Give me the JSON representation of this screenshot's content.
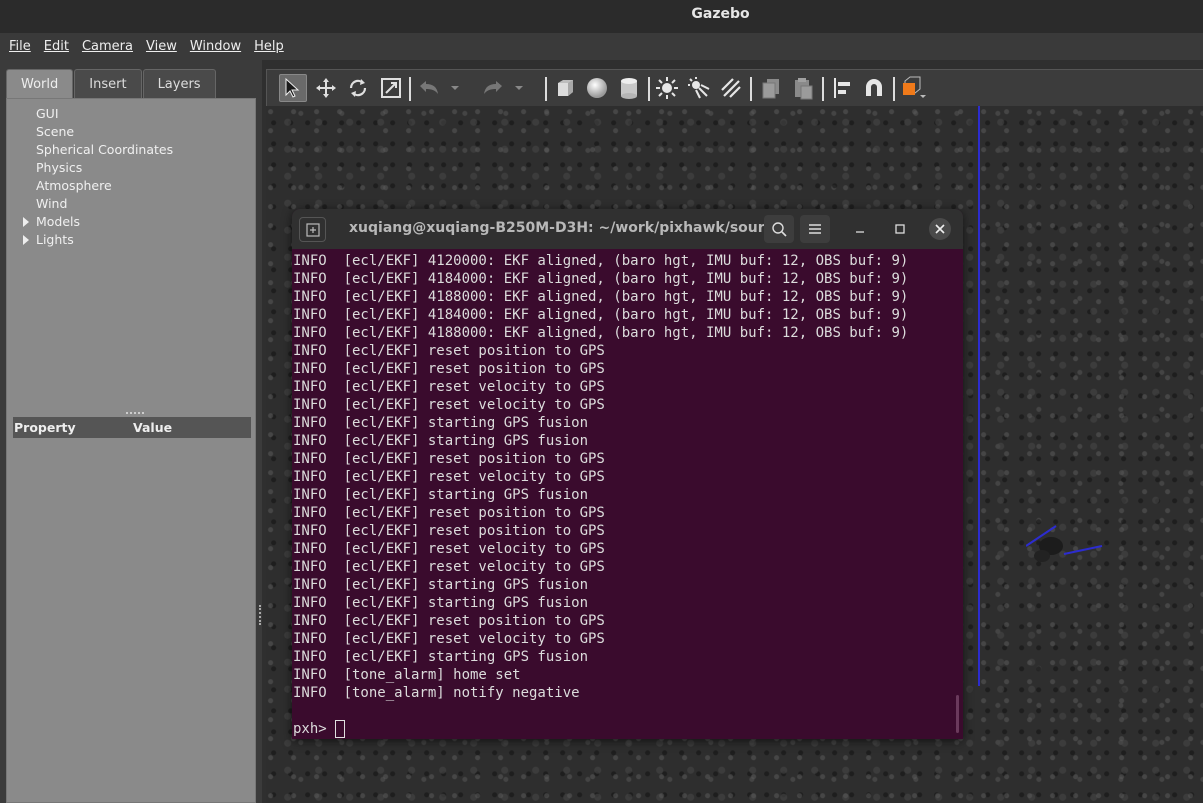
{
  "window": {
    "title": "Gazebo"
  },
  "menu": [
    {
      "label": "File"
    },
    {
      "label": "Edit"
    },
    {
      "label": "Camera"
    },
    {
      "label": "View"
    },
    {
      "label": "Window"
    },
    {
      "label": "Help"
    }
  ],
  "left_panel": {
    "tabs": [
      {
        "label": "World",
        "active": true
      },
      {
        "label": "Insert"
      },
      {
        "label": "Layers"
      }
    ],
    "tree": [
      {
        "label": "GUI",
        "expandable": false
      },
      {
        "label": "Scene",
        "expandable": false
      },
      {
        "label": "Spherical Coordinates",
        "expandable": false
      },
      {
        "label": "Physics",
        "expandable": false
      },
      {
        "label": "Atmosphere",
        "expandable": false
      },
      {
        "label": "Wind",
        "expandable": false
      },
      {
        "label": "Models",
        "expandable": true
      },
      {
        "label": "Lights",
        "expandable": true
      }
    ],
    "property_header": {
      "property": "Property",
      "value": "Value"
    }
  },
  "toolbar": {
    "tools": [
      {
        "icon": "select-arrow-icon",
        "active": true
      },
      {
        "icon": "translate-icon"
      },
      {
        "icon": "rotate-icon"
      },
      {
        "icon": "scale-icon"
      },
      {
        "icon": "undo-icon"
      },
      {
        "icon": "redo-icon"
      },
      {
        "icon": "box-shape-icon"
      },
      {
        "icon": "sphere-shape-icon"
      },
      {
        "icon": "cylinder-shape-icon"
      },
      {
        "icon": "point-light-icon"
      },
      {
        "icon": "spot-light-icon"
      },
      {
        "icon": "directional-light-icon"
      },
      {
        "icon": "copy-icon"
      },
      {
        "icon": "paste-icon"
      },
      {
        "icon": "align-icon"
      },
      {
        "icon": "snap-magnet-icon"
      },
      {
        "icon": "view-angle-icon"
      }
    ],
    "accent_color": "#f07a1a"
  },
  "terminal": {
    "title": "xuqiang@xuqiang-B250M-D3H: ~/work/pixhawk/sourc...",
    "background": "#3a0b2d",
    "lines": [
      "INFO  [ecl/EKF] 4120000: EKF aligned, (baro hgt, IMU buf: 12, OBS buf: 9)",
      "INFO  [ecl/EKF] 4184000: EKF aligned, (baro hgt, IMU buf: 12, OBS buf: 9)",
      "INFO  [ecl/EKF] 4188000: EKF aligned, (baro hgt, IMU buf: 12, OBS buf: 9)",
      "INFO  [ecl/EKF] 4184000: EKF aligned, (baro hgt, IMU buf: 12, OBS buf: 9)",
      "INFO  [ecl/EKF] 4188000: EKF aligned, (baro hgt, IMU buf: 12, OBS buf: 9)",
      "INFO  [ecl/EKF] reset position to GPS",
      "INFO  [ecl/EKF] reset position to GPS",
      "INFO  [ecl/EKF] reset velocity to GPS",
      "INFO  [ecl/EKF] reset velocity to GPS",
      "INFO  [ecl/EKF] starting GPS fusion",
      "INFO  [ecl/EKF] starting GPS fusion",
      "INFO  [ecl/EKF] reset position to GPS",
      "INFO  [ecl/EKF] reset velocity to GPS",
      "INFO  [ecl/EKF] starting GPS fusion",
      "INFO  [ecl/EKF] reset position to GPS",
      "INFO  [ecl/EKF] reset position to GPS",
      "INFO  [ecl/EKF] reset velocity to GPS",
      "INFO  [ecl/EKF] reset velocity to GPS",
      "INFO  [ecl/EKF] starting GPS fusion",
      "INFO  [ecl/EKF] starting GPS fusion",
      "INFO  [ecl/EKF] reset position to GPS",
      "INFO  [ecl/EKF] reset velocity to GPS",
      "INFO  [ecl/EKF] starting GPS fusion",
      "INFO  [tone_alarm] home set",
      "INFO  [tone_alarm] notify negative",
      ""
    ],
    "prompt": "pxh> "
  },
  "scene": {
    "axis_color": "#2c2ccf"
  }
}
